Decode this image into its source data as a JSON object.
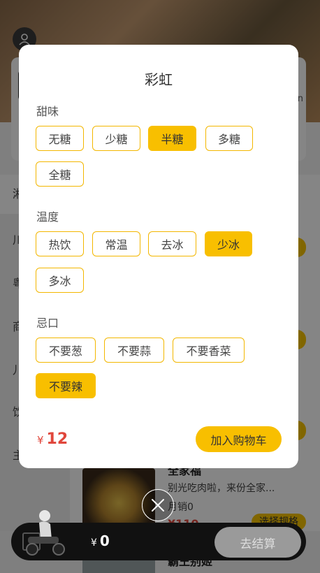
{
  "background": {
    "store_card_partial_text": "n",
    "sidebar": [
      "湘",
      "川",
      "粤",
      "商",
      "儿",
      "饮",
      "主"
    ],
    "dish": {
      "title": "全家福",
      "desc": "别光吃肉啦，来份全家...",
      "sales": "月销0",
      "price": "¥110",
      "spec_button": "选择规格"
    },
    "dish2_title": "霸王别姬"
  },
  "modal": {
    "title": "彩虹",
    "groups": [
      {
        "label": "甜味",
        "options": [
          "无糖",
          "少糖",
          "半糖",
          "多糖",
          "全糖"
        ],
        "selected": "半糖"
      },
      {
        "label": "温度",
        "options": [
          "热饮",
          "常温",
          "去冰",
          "少冰",
          "多冰"
        ],
        "selected": "少冰"
      },
      {
        "label": "忌口",
        "options": [
          "不要葱",
          "不要蒜",
          "不要香菜",
          "不要辣"
        ],
        "selected": "不要辣"
      }
    ],
    "price_currency": "¥",
    "price_amount": "12",
    "add_to_cart_label": "加入购物车"
  },
  "cart": {
    "currency": "¥",
    "total": "0",
    "checkout_label": "去结算"
  },
  "icons": {
    "user": "user-icon",
    "close": "close-icon",
    "cart": "shopping-cart-icon",
    "rider": "delivery-rider-icon"
  },
  "colors": {
    "accent": "#f8bf00",
    "price": "#e0463b",
    "overlay": "rgba(0,0,0,0.48)"
  }
}
